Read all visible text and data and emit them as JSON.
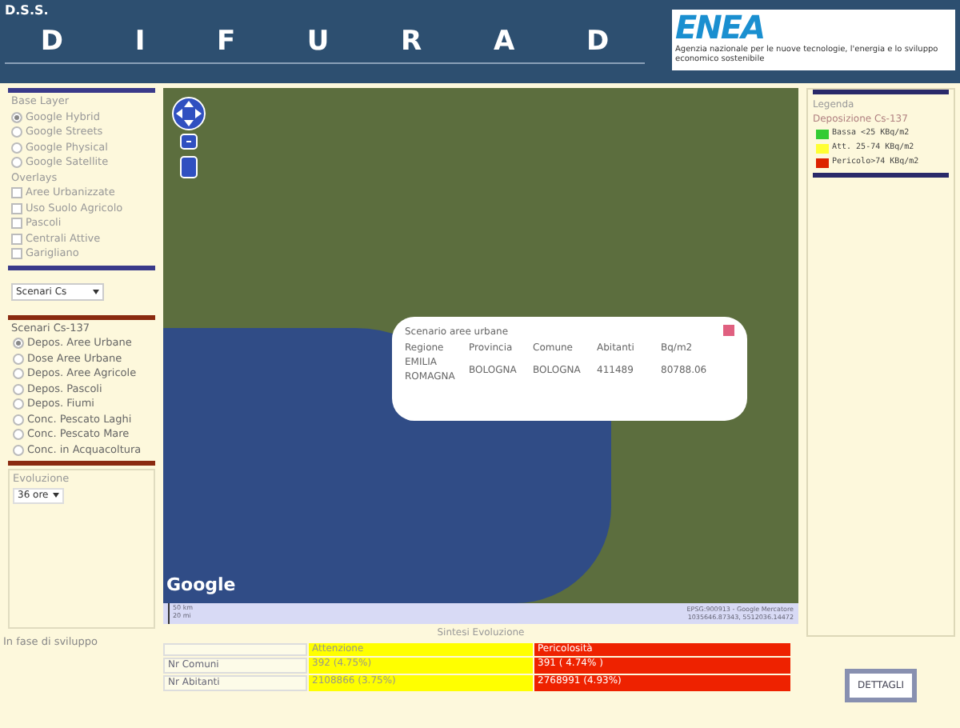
{
  "header": {
    "dss": "D.S.S.",
    "title_letters": [
      "D",
      "I",
      "F",
      "U",
      "R",
      "A",
      "D"
    ],
    "logo": {
      "text": "ENEA",
      "caption": "Agenzia nazionale per le nuove tecnologie, l'energia e lo sviluppo economico sostenibile"
    }
  },
  "left_panel": {
    "base_layer": {
      "title": "Base Layer",
      "options": [
        {
          "label": "Google Hybrid",
          "selected": true
        },
        {
          "label": "Google Streets",
          "selected": false
        },
        {
          "label": "Google Physical",
          "selected": false
        },
        {
          "label": "Google Satellite",
          "selected": false
        }
      ]
    },
    "overlays": {
      "title": "Overlays",
      "items": [
        {
          "label": "Aree Urbanizzate",
          "checked": false
        },
        {
          "label": "Uso Suolo Agricolo",
          "checked": false
        },
        {
          "label": "Pascoli",
          "checked": false
        },
        {
          "label": "Centrali Attive",
          "checked": false
        },
        {
          "label": "Garigliano",
          "checked": false
        }
      ]
    },
    "scenario_select": {
      "value": "Scenari Cs"
    },
    "scenarios": {
      "title": "Scenari Cs-137",
      "options": [
        {
          "label": "Depos. Aree Urbane",
          "selected": true
        },
        {
          "label": "Dose Aree Urbane",
          "selected": false
        },
        {
          "label": "Depos. Aree Agricole",
          "selected": false
        },
        {
          "label": "Depos. Pascoli",
          "selected": false
        },
        {
          "label": "Depos. Fiumi",
          "selected": false
        },
        {
          "label": "Conc. Pescato Laghi",
          "selected": false
        },
        {
          "label": "Conc. Pescato Mare",
          "selected": false
        },
        {
          "label": "Conc. in Acquacoltura",
          "selected": false
        }
      ]
    },
    "evoluzione": {
      "title": "Evoluzione",
      "value": "36 ore"
    }
  },
  "map": {
    "google": "Google",
    "scale": [
      "50 km",
      "20 mi"
    ],
    "attribution": [
      "EPSG:900913 - Google Mercatore",
      "1035646.87343, 5512036.14472"
    ],
    "popup": {
      "title": "Scenario aree urbane",
      "columns": [
        "Regione",
        "Provincia",
        "Comune",
        "Abitanti",
        "Bq/m2"
      ],
      "row": [
        "EMILIA ROMAGNA",
        "BOLOGNA",
        "BOLOGNA",
        "411489",
        "80788.06"
      ]
    }
  },
  "legend": {
    "title": "Legenda",
    "subtitle": "Deposizione Cs-137",
    "items": [
      {
        "label": "Bassa <25 KBq/m2",
        "color": "#33cc33"
      },
      {
        "label": "Att. 25-74 KBq/m2",
        "color": "#ffff33"
      },
      {
        "label": "Pericolo>74 KBq/m2",
        "color": "#dd2200"
      }
    ]
  },
  "status": "In fase di sviluppo",
  "summary": {
    "title": "Sintesi Evoluzione",
    "columns": [
      {
        "label": "Attenzione",
        "color": "#ffff00"
      },
      {
        "label": "Pericolosità",
        "color": "#ee2200"
      }
    ],
    "rows": [
      {
        "label": "Nr Comuni",
        "values": [
          "392 (4.75%)",
          "391 ( 4.74% )"
        ]
      },
      {
        "label": "Nr Abitanti",
        "values": [
          "2108866 (3.75%)",
          "2768991 (4.93%)"
        ]
      }
    ]
  },
  "button": "DETTAGLI"
}
